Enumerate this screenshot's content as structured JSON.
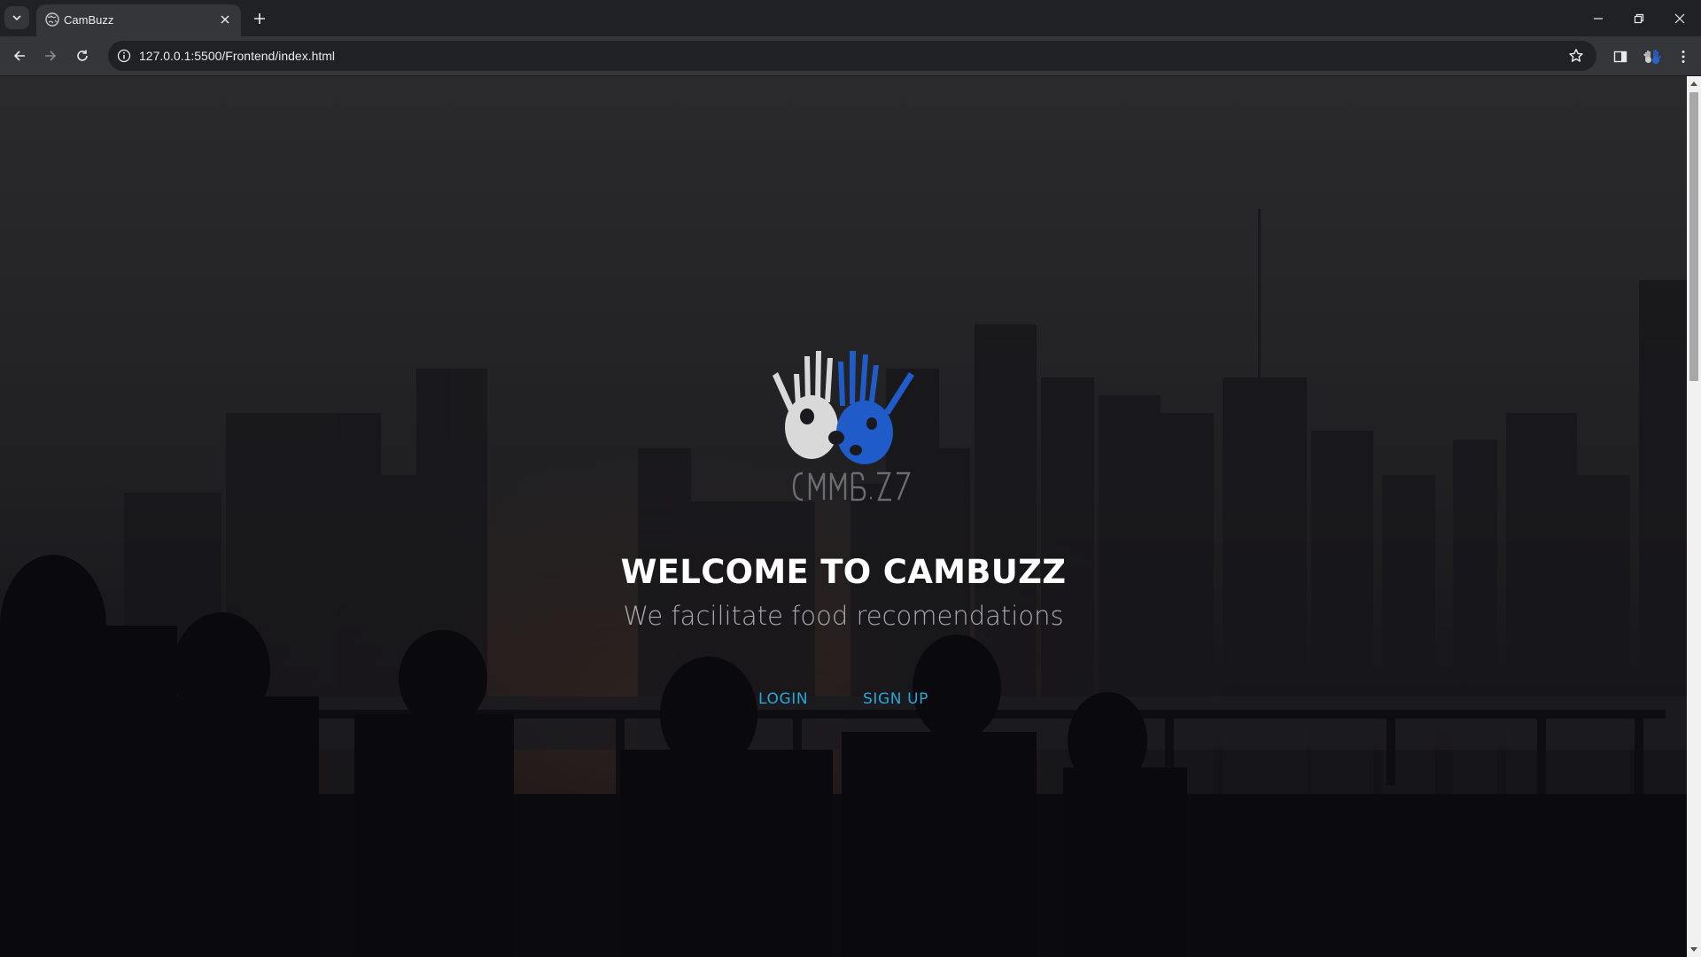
{
  "browser": {
    "tab": {
      "title": "CamBuzz",
      "favicon": "globe-icon"
    },
    "url": "127.0.0.1:5500/Frontend/index.html",
    "colors": {
      "chrome_dark": "#202124",
      "chrome_mid": "#35363a",
      "text": "#e8eaed"
    }
  },
  "page": {
    "logo": {
      "wordmark": "CAMBUZZ",
      "colors": {
        "left_hand": "#d9d9d9",
        "right_hand": "#1f5cc9"
      }
    },
    "headline": "WELCOME TO CAMBUZZ",
    "tagline": "We facilitate food recomendations",
    "nav": {
      "login_label": "LOGIN",
      "signup_label": "SIGN UP"
    },
    "colors": {
      "link": "#28a7d9",
      "headline": "#ffffff",
      "tagline": "#a9a9ad"
    }
  }
}
